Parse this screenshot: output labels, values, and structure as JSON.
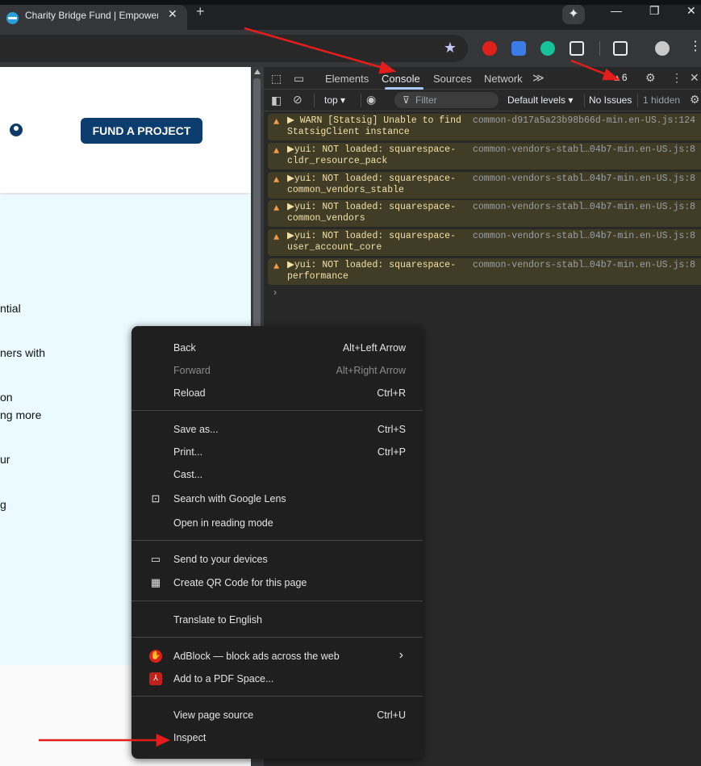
{
  "browser": {
    "tab_title": "Charity Bridge Fund | Empowering",
    "tab_close": "✕",
    "new_tab": "+",
    "gemini": "✦",
    "window_minimize": "—",
    "window_restore": "❐",
    "window_close": "✕",
    "bookmark_star": "★",
    "menu": "⋮"
  },
  "page": {
    "fund_button": "FUND A PROJECT",
    "fragments": [
      "ntial",
      "ners with",
      "on",
      "ng more",
      "ur",
      "g"
    ]
  },
  "devtools": {
    "tabs": [
      "Elements",
      "Console",
      "Sources",
      "Network"
    ],
    "active_tab": "Console",
    "more_tabs": "≫",
    "warning_count": "6",
    "context": "top",
    "filter_placeholder": "Filter",
    "levels": "Default levels",
    "issues": "No Issues",
    "hidden": "1 hidden",
    "prompt": "›",
    "messages": [
      {
        "text": "▶  WARN  [Statsig] Unable to find StatsigClient instance",
        "source": "common-d917a5a23b98b66d-min.en-US.js:124"
      },
      {
        "text": "▶yui: NOT loaded: squarespace-cldr_resource_pack",
        "source": "common-vendors-stabl…04b7-min.en-US.js:8"
      },
      {
        "text": "▶yui: NOT loaded: squarespace-common_vendors_stable",
        "source": "common-vendors-stabl…04b7-min.en-US.js:8"
      },
      {
        "text": "▶yui: NOT loaded: squarespace-common_vendors",
        "source": "common-vendors-stabl…04b7-min.en-US.js:8"
      },
      {
        "text": "▶yui: NOT loaded: squarespace-user_account_core",
        "source": "common-vendors-stabl…04b7-min.en-US.js:8"
      },
      {
        "text": "▶yui: NOT loaded: squarespace-performance",
        "source": "common-vendors-stabl…04b7-min.en-US.js:8"
      }
    ]
  },
  "context_menu": {
    "back": {
      "label": "Back",
      "shortcut": "Alt+Left Arrow"
    },
    "forward": {
      "label": "Forward",
      "shortcut": "Alt+Right Arrow"
    },
    "reload": {
      "label": "Reload",
      "shortcut": "Ctrl+R"
    },
    "save_as": {
      "label": "Save as...",
      "shortcut": "Ctrl+S"
    },
    "print": {
      "label": "Print...",
      "shortcut": "Ctrl+P"
    },
    "cast": {
      "label": "Cast..."
    },
    "lens": {
      "label": "Search with Google Lens"
    },
    "reading_mode": {
      "label": "Open in reading mode"
    },
    "send_devices": {
      "label": "Send to your devices"
    },
    "qr_code": {
      "label": "Create QR Code for this page"
    },
    "translate": {
      "label": "Translate to English"
    },
    "adblock": {
      "label": "AdBlock — block ads across the web",
      "submenu": "›"
    },
    "pdf_space": {
      "label": "Add to a PDF Space..."
    },
    "view_source": {
      "label": "View page source",
      "shortcut": "Ctrl+U"
    },
    "inspect": {
      "label": "Inspect"
    }
  },
  "colors": {
    "accent_blue": "#0d3c6e",
    "warning_bg": "#413c26",
    "arrow_red": "#e51c1c"
  }
}
